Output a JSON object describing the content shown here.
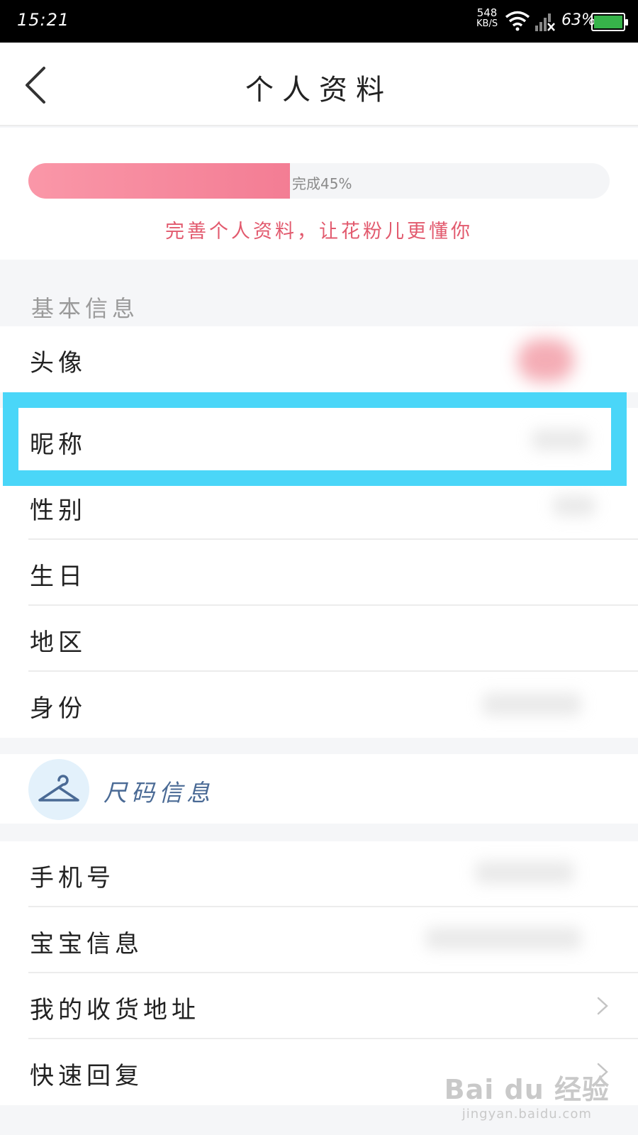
{
  "status_bar": {
    "time": "15:21",
    "net_speed_value": "548",
    "net_speed_unit": "KB/S",
    "battery_percent": "63%",
    "icons": [
      "wifi-icon",
      "signal-icon",
      "battery-icon"
    ]
  },
  "header": {
    "title": "个人资料",
    "back_icon": "chevron-left-icon"
  },
  "progress": {
    "value_percent": 45,
    "label": "完成45%",
    "hint": "完善个人资料，让花粉儿更懂你"
  },
  "basic_info": {
    "section_title": "基本信息",
    "items": [
      {
        "label": "头像"
      },
      {
        "label": "昵称"
      },
      {
        "label": "性别"
      },
      {
        "label": "生日"
      },
      {
        "label": "地区"
      },
      {
        "label": "身份"
      }
    ]
  },
  "size_info": {
    "label": "尺码信息",
    "icon": "hanger-icon"
  },
  "other_items": [
    {
      "label": "手机号"
    },
    {
      "label": "宝宝信息"
    },
    {
      "label": "我的收货地址"
    },
    {
      "label": "快速回复"
    }
  ],
  "watermark": {
    "brand": "Bai du 经验",
    "url": "jingyan.baidu.com"
  },
  "colors": {
    "highlight": "#4ad6f8",
    "progress_start": "#fa97a8",
    "progress_end": "#f37d94",
    "hint_text": "#e25a6e"
  }
}
